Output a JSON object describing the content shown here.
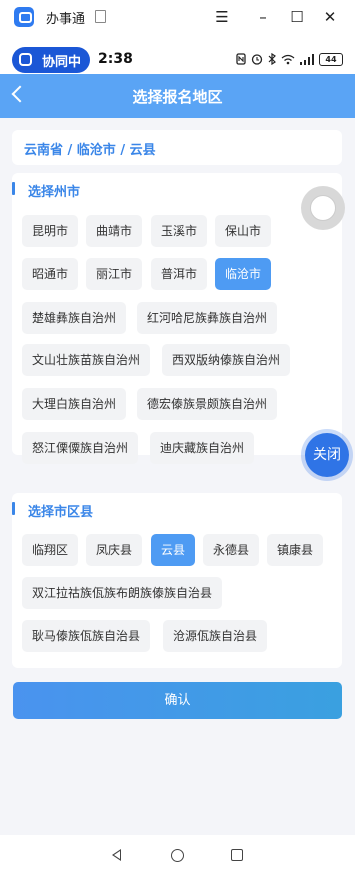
{
  "window": {
    "title": "办事通",
    "menu_glyph": "☰",
    "minimize_glyph": "–",
    "maximize_glyph": "☐",
    "close_glyph": "✕"
  },
  "statusbar": {
    "pill_label": "协同中",
    "time": "2:38",
    "battery": "44",
    "icons": [
      "nfc-icon",
      "alarm-icon",
      "bluetooth-icon",
      "wifi-icon",
      "signal-icon",
      "battery-icon"
    ]
  },
  "header": {
    "title": "选择报名地区"
  },
  "selected_path": "云南省 / 临沧市 / 云县",
  "city_section": {
    "title": "选择州市",
    "items": [
      {
        "label": "昆明市",
        "active": false
      },
      {
        "label": "曲靖市",
        "active": false
      },
      {
        "label": "玉溪市",
        "active": false
      },
      {
        "label": "保山市",
        "active": false
      },
      {
        "label": "昭通市",
        "active": false
      },
      {
        "label": "丽江市",
        "active": false
      },
      {
        "label": "普洱市",
        "active": false
      },
      {
        "label": "临沧市",
        "active": true
      },
      {
        "label": "楚雄彝族自治州",
        "active": false
      },
      {
        "label": "红河哈尼族彝族自治州",
        "active": false
      },
      {
        "label": "文山壮族苗族自治州",
        "active": false
      },
      {
        "label": "西双版纳傣族自治州",
        "active": false
      },
      {
        "label": "大理白族自治州",
        "active": false
      },
      {
        "label": "德宏傣族景颇族自治州",
        "active": false
      },
      {
        "label": "怒江傈僳族自治州",
        "active": false
      },
      {
        "label": "迪庆藏族自治州",
        "active": false
      }
    ]
  },
  "county_section": {
    "title": "选择市区县",
    "items": [
      {
        "label": "临翔区",
        "active": false
      },
      {
        "label": "凤庆县",
        "active": false
      },
      {
        "label": "云县",
        "active": true
      },
      {
        "label": "永德县",
        "active": false
      },
      {
        "label": "镇康县",
        "active": false
      },
      {
        "label": "双江拉祜族佤族布朗族傣族自治县",
        "active": false
      },
      {
        "label": "耿马傣族佤族自治县",
        "active": false
      },
      {
        "label": "沧源佤族自治县",
        "active": false
      }
    ]
  },
  "confirm_label": "确认",
  "float_close_label": "关闭",
  "colors": {
    "accent": "#4e9bf3",
    "header": "#5aa4f5",
    "section_title": "#3a86e8",
    "pill": "#1b57d6"
  }
}
